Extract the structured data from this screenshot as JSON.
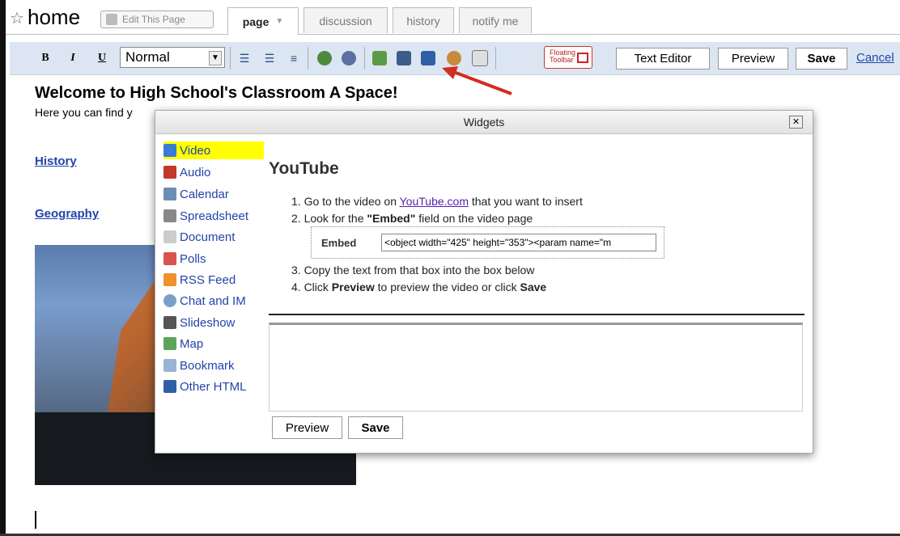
{
  "header": {
    "page_title": "home",
    "edit_page_label": "Edit This Page",
    "tabs": [
      {
        "label": "page",
        "has_dropdown": true,
        "active": true
      },
      {
        "label": "discussion"
      },
      {
        "label": "history"
      },
      {
        "label": "notify me"
      }
    ]
  },
  "toolbar": {
    "bold": "B",
    "italic": "I",
    "underline": "U",
    "format_value": "Normal",
    "floating_label_1": "Floating",
    "floating_label_2": "Toolbar",
    "text_editor": "Text Editor",
    "preview": "Preview",
    "save": "Save",
    "cancel": "Cancel",
    "icons": [
      "numbered-list-icon",
      "bullet-list-icon",
      "indent-icon",
      "link-icon",
      "unlink-icon",
      "image-icon",
      "widget-tv-icon",
      "table-icon",
      "special-icon",
      "file-icon"
    ]
  },
  "page": {
    "heading": "Welcome to High School's Classroom A Space!",
    "intro": "Here you can find y",
    "links": [
      "History",
      "Geography"
    ]
  },
  "dialog": {
    "title": "Widgets",
    "close": "✕",
    "widgets": [
      {
        "label": "Video",
        "icon": "tv-icon",
        "color": "#3a7bd5",
        "selected": true
      },
      {
        "label": "Audio",
        "icon": "speaker-icon",
        "color": "#c0392b"
      },
      {
        "label": "Calendar",
        "icon": "calendar-icon",
        "color": "#6a8fb3"
      },
      {
        "label": "Spreadsheet",
        "icon": "spreadsheet-icon",
        "color": "#888888"
      },
      {
        "label": "Document",
        "icon": "document-icon",
        "color": "#bbbbbb"
      },
      {
        "label": "Polls",
        "icon": "poll-chart-icon",
        "color": "#d9534f"
      },
      {
        "label": "RSS Feed",
        "icon": "rss-icon",
        "color": "#f0912b"
      },
      {
        "label": "Chat and IM",
        "icon": "chat-icon",
        "color": "#7aa0c8"
      },
      {
        "label": "Slideshow",
        "icon": "camera-icon",
        "color": "#555555"
      },
      {
        "label": "Map",
        "icon": "map-icon",
        "color": "#5ca35c"
      },
      {
        "label": "Bookmark",
        "icon": "tag-icon",
        "color": "#9ab4d6"
      },
      {
        "label": "Other HTML",
        "icon": "html-icon",
        "color": "#2f5fa7"
      }
    ],
    "heading": "YouTube",
    "step1_prefix": "1.  Go to the video on ",
    "step1_link": "YouTube.com",
    "step1_suffix": " that you want to insert",
    "step2_prefix": "2.  Look for the ",
    "step2_bold": "\"Embed\"",
    "step2_suffix": " field on the video page",
    "embed_label": "Embed",
    "embed_value": "<object width=\"425\" height=\"353\"><param name=\"m",
    "step3": "3.  Copy the text from that box into the box below",
    "step4_prefix": "4.  Click ",
    "step4_bold1": "Preview",
    "step4_mid": " to preview the video or click ",
    "step4_bold2": "Save",
    "preview_btn": "Preview",
    "save_btn": "Save"
  }
}
